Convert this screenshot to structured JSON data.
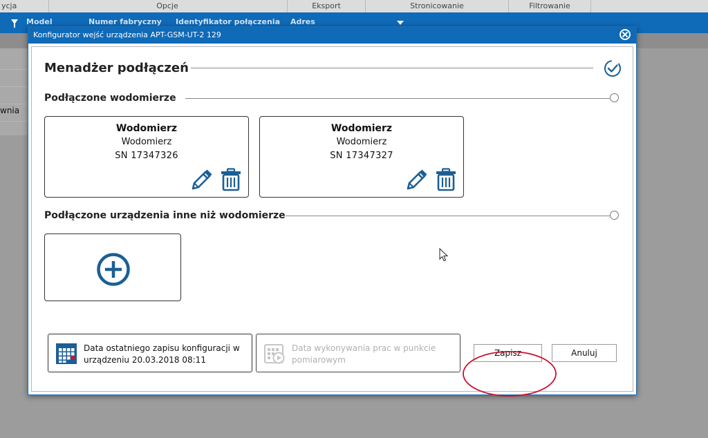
{
  "background": {
    "ribbon_tabs": [
      "ycja",
      "Opcje",
      "Eksport",
      "Stronicowanie",
      "Filtrowanie"
    ],
    "columns": [
      "Model",
      "Numer fabryczny",
      "Identyfikator połączenia",
      "Adres"
    ],
    "row_text": "wnia"
  },
  "dialog": {
    "title": "Konfigurator wejść urządzenia APT-GSM-UT-2 129",
    "header": "Menadżer podłączeń",
    "section_meters": "Podłączone wodomierze",
    "section_other": "Podłączone urządzenia inne niż wodomierze",
    "meters": [
      {
        "name": "Wodomierz",
        "type": "Wodomierz",
        "sn": "SN  17347326"
      },
      {
        "name": "Wodomierz",
        "type": "Wodomierz",
        "sn": "SN  17347327"
      }
    ],
    "last_save_label": "Data ostatniego zapisu konfiguracji w urządzeniu 20.03.2018 08:11",
    "work_date_label": "Data wykonywania prac w punkcie pomiarowym",
    "save_label": "Zapisz",
    "cancel_label": "Anuluj"
  },
  "colors": {
    "accent": "#0f6ab8",
    "icon_blue": "#1b5f95",
    "annotation_red": "#c8102e"
  },
  "icons": [
    "filter-icon",
    "close-icon",
    "check-circle-icon",
    "radio-icon",
    "pencil-icon",
    "trash-icon",
    "plus-circle-icon",
    "calendar-icon",
    "calendar-play-icon",
    "cursor-icon"
  ]
}
